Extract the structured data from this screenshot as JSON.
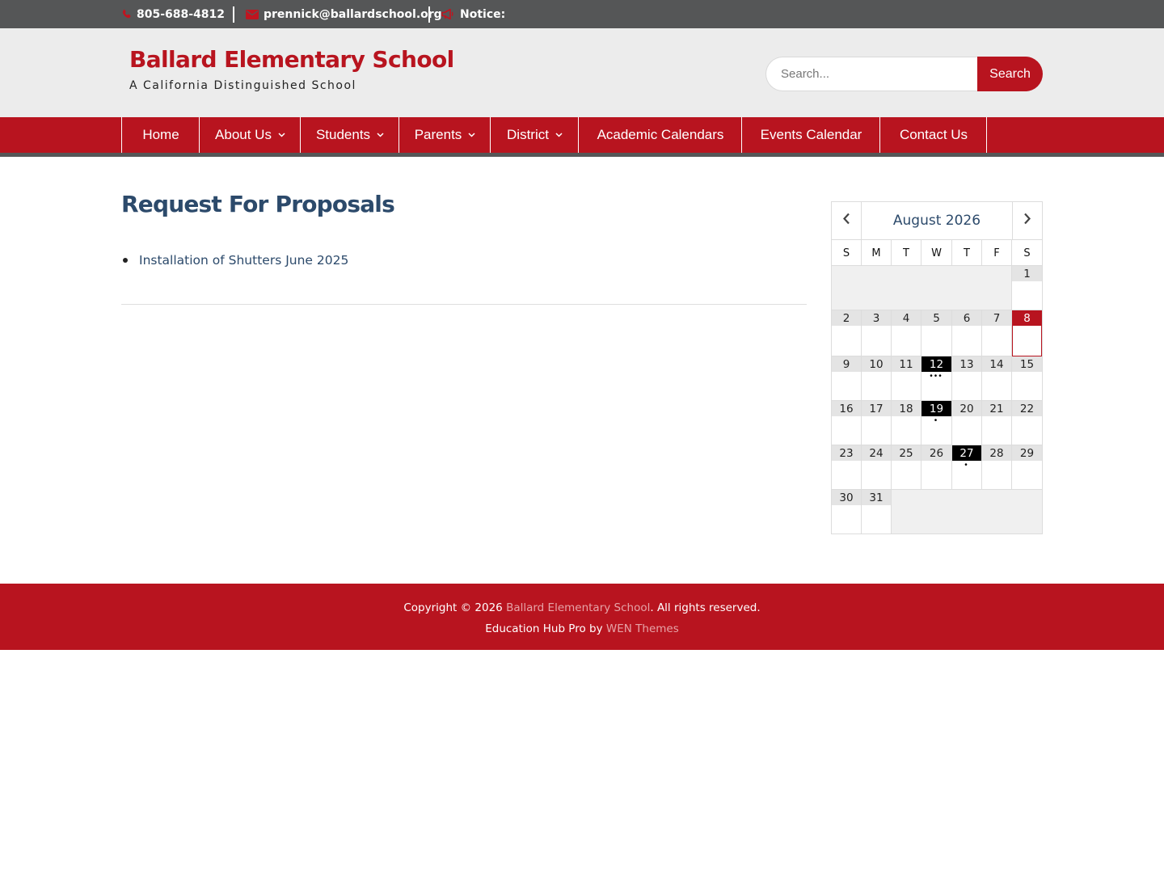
{
  "topbar": {
    "phone": "805-688-4812",
    "email": "prennick@ballardschool.org",
    "notice": "Notice:",
    "icons": {
      "phone": "phone-icon",
      "email": "envelope-icon",
      "notice": "bullhorn-icon"
    }
  },
  "header": {
    "title": "Ballard Elementary School",
    "tagline": "A California Distinguished School",
    "search_placeholder": "Search...",
    "search_button": "Search"
  },
  "nav": {
    "items": [
      {
        "label": "Home",
        "has_dropdown": false
      },
      {
        "label": "About Us",
        "has_dropdown": true
      },
      {
        "label": "Students",
        "has_dropdown": true
      },
      {
        "label": "Parents",
        "has_dropdown": true
      },
      {
        "label": "District",
        "has_dropdown": true
      },
      {
        "label": "Academic Calendars",
        "has_dropdown": false
      },
      {
        "label": "Events Calendar",
        "has_dropdown": false
      },
      {
        "label": "Contact Us",
        "has_dropdown": false
      }
    ]
  },
  "main": {
    "title": "Request For Proposals",
    "links": [
      "Installation of Shutters June 2025"
    ]
  },
  "calendar": {
    "month": "August 2026",
    "weekdays": [
      "S",
      "M",
      "T",
      "W",
      "T",
      "F",
      "S"
    ],
    "first_weekday": 6,
    "days_in_month": 31,
    "today": 8,
    "event_days": {
      "12": 3,
      "19": 1,
      "27": 1
    }
  },
  "footer": {
    "copyright_prefix": "Copyright © 2026 ",
    "school_link": "Ballard Elementary School",
    "copyright_suffix": ". All rights reserved.",
    "theme_prefix": "Education Hub Pro by ",
    "theme_link": "WEN Themes"
  },
  "colors": {
    "brand_red": "#b8141f",
    "topbar_gray": "#555657",
    "header_bg": "#ececec",
    "title_blue": "#2c4a6b"
  }
}
